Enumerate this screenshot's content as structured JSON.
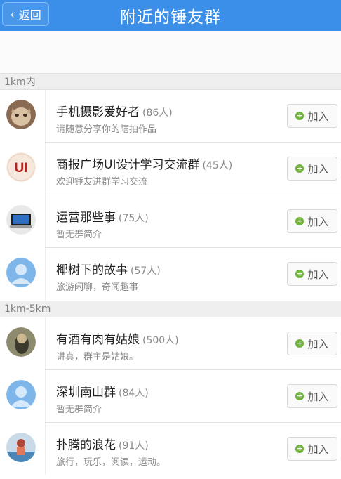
{
  "header": {
    "back_label": "返回",
    "title": "附近的锤友群"
  },
  "sections": [
    {
      "label": "1km内"
    },
    {
      "label": "1km-5km"
    }
  ],
  "join_label": "加入",
  "groups": [
    {
      "name": "手机摄影爱好者",
      "count": "(86人)",
      "desc": "请随意分享你的瞎拍作品"
    },
    {
      "name": "商报广场UI设计学习交流群",
      "count": "(45人)",
      "desc": "欢迎锤友进群学习交流"
    },
    {
      "name": "运营那些事",
      "count": "(75人)",
      "desc": "暂无群简介"
    },
    {
      "name": "椰树下的故事",
      "count": "(57人)",
      "desc": "旅游闲聊，奇闻趣事"
    },
    {
      "name": "有酒有肉有姑娘",
      "count": "(500人)",
      "desc": "讲真，群主是姑娘。"
    },
    {
      "name": "深圳南山群",
      "count": "(84人)",
      "desc": "暂无群简介"
    },
    {
      "name": "扑腾的浪花",
      "count": "(91人)",
      "desc": "旅行，玩乐，阅读，运动。"
    }
  ],
  "avatar_ui_text": "UI",
  "colors": {
    "header_bg": "#3b8fe8",
    "plus_green": "#6fb33a"
  }
}
